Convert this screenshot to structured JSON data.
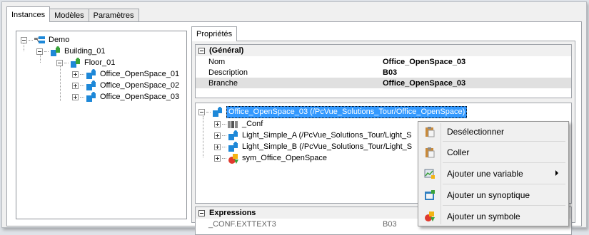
{
  "tabs": [
    "Instances",
    "Modèles",
    "Paramètres"
  ],
  "tree": {
    "root": "Demo",
    "building": "Building_01",
    "floor": "Floor_01",
    "offices": [
      "Office_OpenSpace_01",
      "Office_OpenSpace_02",
      "Office_OpenSpace_03"
    ]
  },
  "properties": {
    "tab_label": "Propriétés",
    "general": {
      "header": "(Général)",
      "rows": [
        {
          "key": "Nom",
          "value": "Office_OpenSpace_03"
        },
        {
          "key": "Description",
          "value": "B03"
        },
        {
          "key": "Branche",
          "value": "Office_OpenSpace_03"
        }
      ]
    },
    "instance_tree": {
      "root": "Office_OpenSpace_03 (/PcVue_Solutions_Tour/Office_OpenSpace)",
      "children": [
        "_Conf",
        "Light_Simple_A (/PcVue_Solutions_Tour/Light_S",
        "Light_Simple_B (/PcVue_Solutions_Tour/Light_S",
        "sym_Office_OpenSpace"
      ]
    },
    "expressions": {
      "header": "Expressions",
      "rows": [
        {
          "key": "_CONF.EXTTEXT3",
          "value": "B03"
        }
      ]
    }
  },
  "context_menu": {
    "items": [
      {
        "label": "Desélectionner",
        "icon": "clipboard-icon"
      },
      {
        "label": "Coller",
        "icon": "paste-icon"
      },
      {
        "label": "Ajouter une variable",
        "icon": "add-variable-icon",
        "submenu": true
      },
      {
        "label": "Ajouter un synoptique",
        "icon": "add-mimic-icon"
      },
      {
        "label": "Ajouter un symbole",
        "icon": "add-symbol-icon"
      }
    ]
  },
  "colors": {
    "selection": "#3399ff",
    "puzzle_blue": "#1e88d8",
    "puzzle_green": "#3aa33a"
  }
}
